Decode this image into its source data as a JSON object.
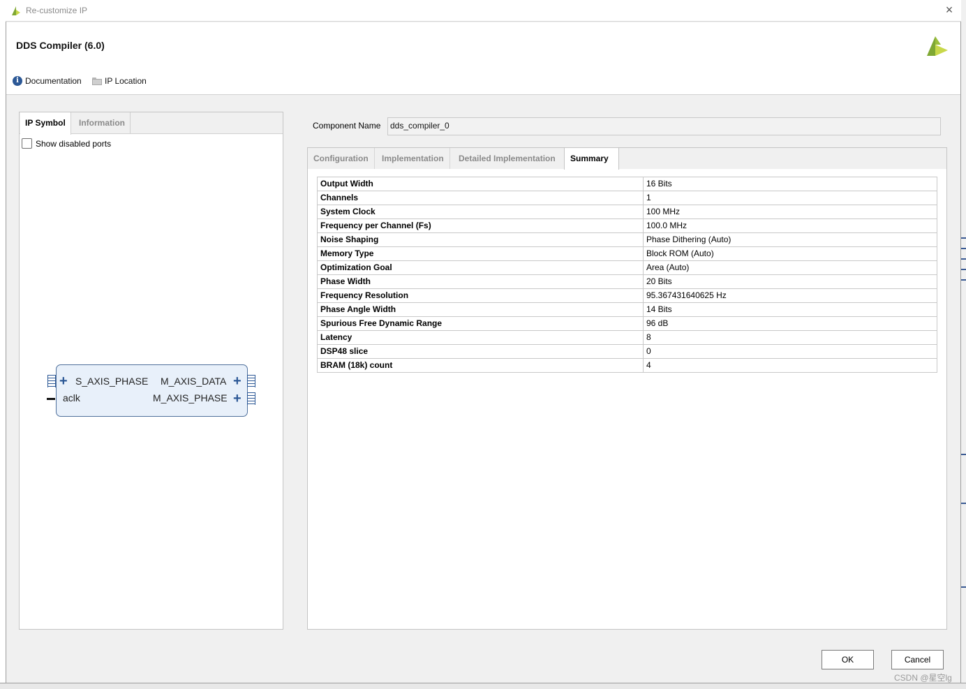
{
  "window": {
    "title": "Re-customize IP",
    "close_symbol": "×"
  },
  "header": {
    "ip_title": "DDS Compiler (6.0)",
    "documentation_label": "Documentation",
    "ip_location_label": "IP Location"
  },
  "left_panel": {
    "tabs": [
      {
        "label": "IP Symbol",
        "active": true
      },
      {
        "label": "Information",
        "active": false
      }
    ],
    "show_disabled_ports_label": "Show disabled ports",
    "show_disabled_ports_checked": false,
    "symbol": {
      "ports_left": [
        {
          "label": "S_AXIS_PHASE",
          "kind": "bus"
        },
        {
          "label": "aclk",
          "kind": "clock"
        }
      ],
      "ports_right": [
        {
          "label": "M_AXIS_DATA",
          "kind": "bus"
        },
        {
          "label": "M_AXIS_PHASE",
          "kind": "bus"
        }
      ],
      "expand_symbol": "+"
    }
  },
  "component": {
    "label": "Component Name",
    "value": "dds_compiler_0"
  },
  "right_tabs": [
    {
      "label": "Configuration",
      "active": false
    },
    {
      "label": "Implementation",
      "active": false
    },
    {
      "label": "Detailed Implementation",
      "active": false
    },
    {
      "label": "Summary",
      "active": true
    }
  ],
  "summary": [
    {
      "key": "Output Width",
      "value": "16 Bits"
    },
    {
      "key": "Channels",
      "value": "1"
    },
    {
      "key": "System Clock",
      "value": "100 MHz"
    },
    {
      "key": "Frequency per Channel (Fs)",
      "value": "100.0 MHz"
    },
    {
      "key": "Noise Shaping",
      "value": "Phase Dithering (Auto)"
    },
    {
      "key": "Memory Type",
      "value": "Block ROM (Auto)"
    },
    {
      "key": "Optimization Goal",
      "value": "Area (Auto)"
    },
    {
      "key": "Phase Width",
      "value": "20 Bits"
    },
    {
      "key": "Frequency Resolution",
      "value": "95.367431640625 Hz"
    },
    {
      "key": "Phase Angle Width",
      "value": "14 Bits"
    },
    {
      "key": "Spurious Free Dynamic Range",
      "value": "96 dB"
    },
    {
      "key": "Latency",
      "value": "8"
    },
    {
      "key": "DSP48 slice",
      "value": "0"
    },
    {
      "key": "BRAM (18k) count",
      "value": "4"
    }
  ],
  "buttons": {
    "ok": "OK",
    "cancel": "Cancel"
  },
  "watermark": "CSDN @星空lg",
  "colors": {
    "accent_blue": "#2c5896",
    "logo_green": "#7fa833",
    "logo_yellow": "#c8d84a"
  }
}
